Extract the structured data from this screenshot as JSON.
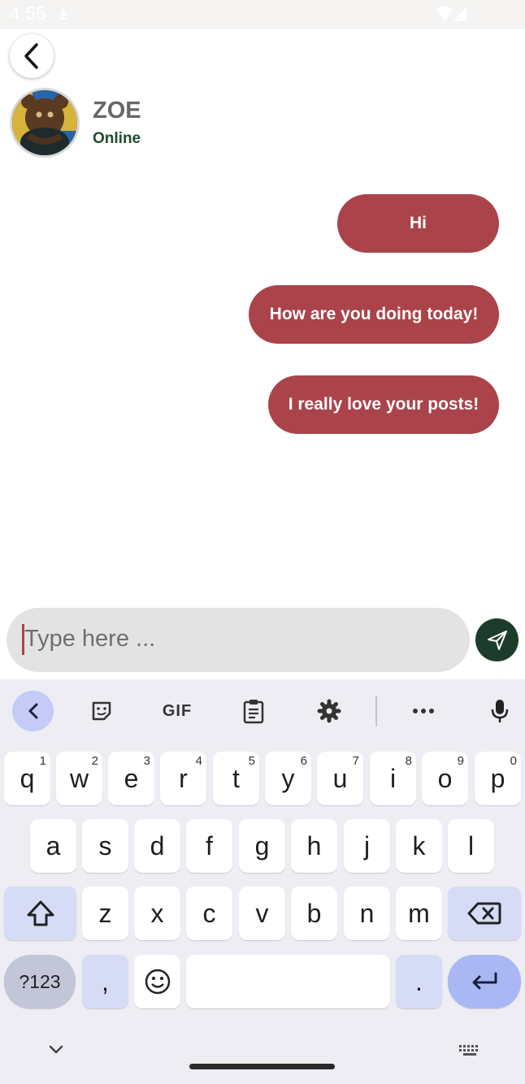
{
  "status_bar": {
    "time": "4:55"
  },
  "header": {
    "contact_name": "ZOE",
    "contact_status": "Online"
  },
  "messages": [
    {
      "text": "Hi",
      "sender": "me"
    },
    {
      "text": "How are you doing today!",
      "sender": "me"
    },
    {
      "text": "I really love your posts!",
      "sender": "me"
    }
  ],
  "composer": {
    "placeholder": "Type here ..."
  },
  "keyboard": {
    "toolbar": [
      "chevron-left-icon",
      "sticker-icon",
      "GIF",
      "clipboard-icon",
      "gear-icon",
      "more-icon",
      "mic-icon"
    ],
    "gif_label": "GIF",
    "row1": [
      {
        "key": "q",
        "hint": "1"
      },
      {
        "key": "w",
        "hint": "2"
      },
      {
        "key": "e",
        "hint": "3"
      },
      {
        "key": "r",
        "hint": "4"
      },
      {
        "key": "t",
        "hint": "5"
      },
      {
        "key": "y",
        "hint": "6"
      },
      {
        "key": "u",
        "hint": "7"
      },
      {
        "key": "i",
        "hint": "8"
      },
      {
        "key": "o",
        "hint": "9"
      },
      {
        "key": "p",
        "hint": "0"
      }
    ],
    "row2": [
      "a",
      "s",
      "d",
      "f",
      "g",
      "h",
      "j",
      "k",
      "l"
    ],
    "row3": [
      "z",
      "x",
      "c",
      "v",
      "b",
      "n",
      "m"
    ],
    "numbers_label": "?123",
    "comma": ",",
    "period": "."
  },
  "colors": {
    "bubble": "#ab434a",
    "send_button": "#1e3c2c",
    "online": "#1d4d2c",
    "keyboard_bg": "#eeedf3",
    "accent_key": "#a9b8f5"
  }
}
